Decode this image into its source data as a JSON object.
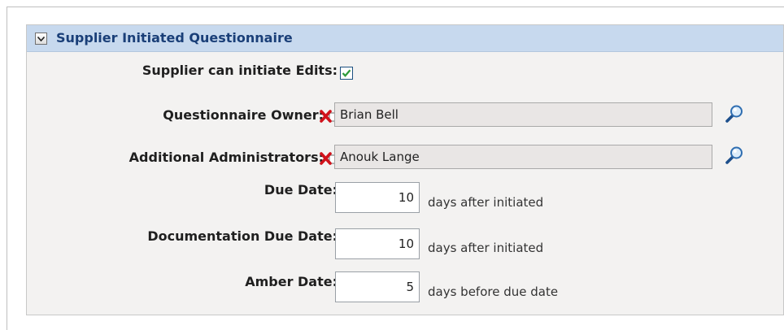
{
  "section": {
    "title": "Supplier Initiated Questionnaire",
    "collapse_icon": "chevron-down-icon"
  },
  "supplier_can_initiate_edits": {
    "label": "Supplier can initiate Edits:",
    "checked": true
  },
  "questionnaire_owner": {
    "label": "Questionnaire Owner:",
    "value": "Brian Bell",
    "clear_icon": "red-x-icon",
    "lookup_icon": "magnifier-icon"
  },
  "additional_administrators": {
    "label": "Additional Administrators:",
    "value": "Anouk Lange",
    "clear_icon": "red-x-icon",
    "lookup_icon": "magnifier-icon"
  },
  "due_date": {
    "label": "Due Date:",
    "value": "10",
    "suffix": "days after initiated"
  },
  "documentation_due_date": {
    "label": "Documentation Due Date:",
    "value": "10",
    "suffix": "days after initiated"
  },
  "amber_date": {
    "label": "Amber Date:",
    "value": "5",
    "suffix": "days before due date"
  },
  "colors": {
    "header_bg": "#c7d9ee",
    "title_text": "#1a3f78",
    "panel_bg": "#f3f2f1",
    "checkmark": "#2e9b3a",
    "clear_red": "#d0121b"
  }
}
